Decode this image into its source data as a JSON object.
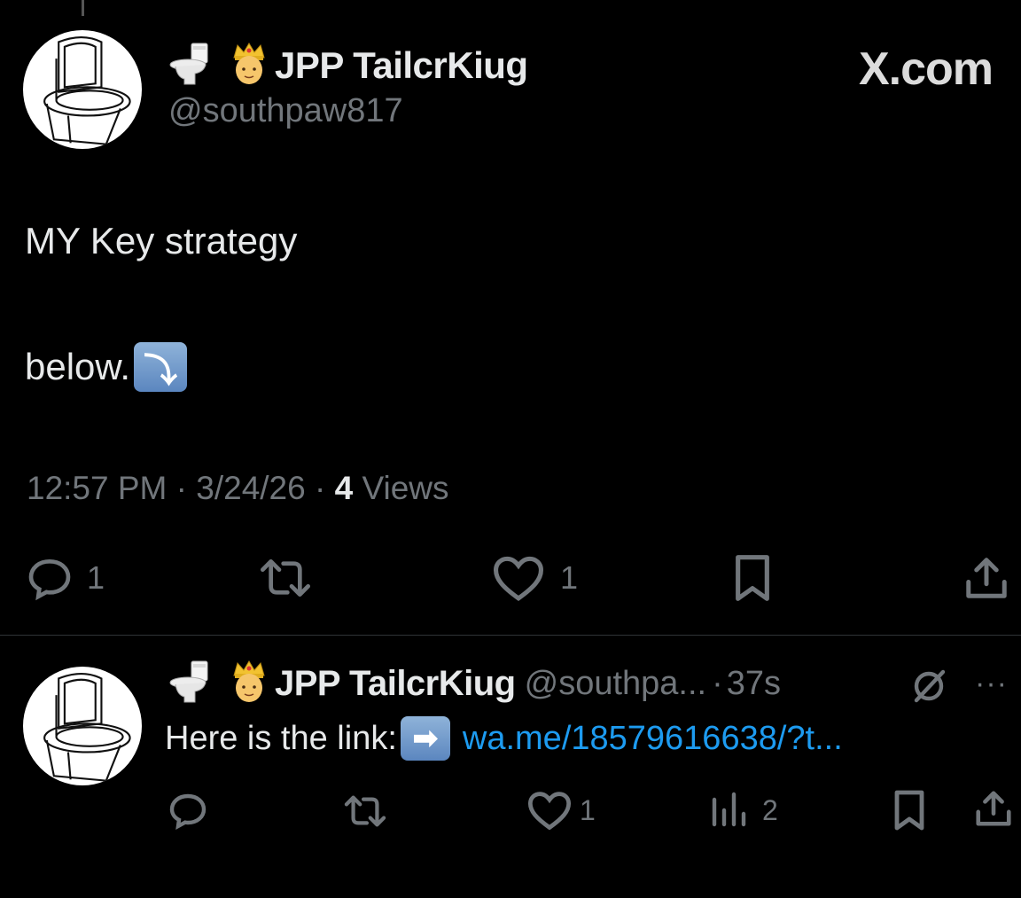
{
  "main_tweet": {
    "display_name": "JPP TailcrKiug",
    "handle": "@southpaw817",
    "site_label": "X.com",
    "text_line1": "MY Key strategy",
    "text_line2": "below.",
    "text_emoji": "⤵",
    "time": "12:57 PM",
    "date": "3/24/26",
    "views_count": "4",
    "views_label": "Views",
    "sep": "·",
    "reply_count": "1",
    "like_count": "1"
  },
  "reply_tweet": {
    "display_name": "JPP TailcrKiug",
    "handle": "@southpa...",
    "sep": "·",
    "time": "37s",
    "more": "···",
    "text": "Here is the link:",
    "arrow": "➡",
    "link": "wa.me/18579616638/?t...",
    "like_count": "1",
    "views_count": "2"
  },
  "icons": {
    "name_prefix": [
      "toilet-icon",
      "crowned-person-icon"
    ],
    "actions": [
      "reply-icon",
      "retweet-icon",
      "like-icon",
      "bookmark-icon",
      "share-icon",
      "views-icon",
      "grok-icon"
    ]
  }
}
